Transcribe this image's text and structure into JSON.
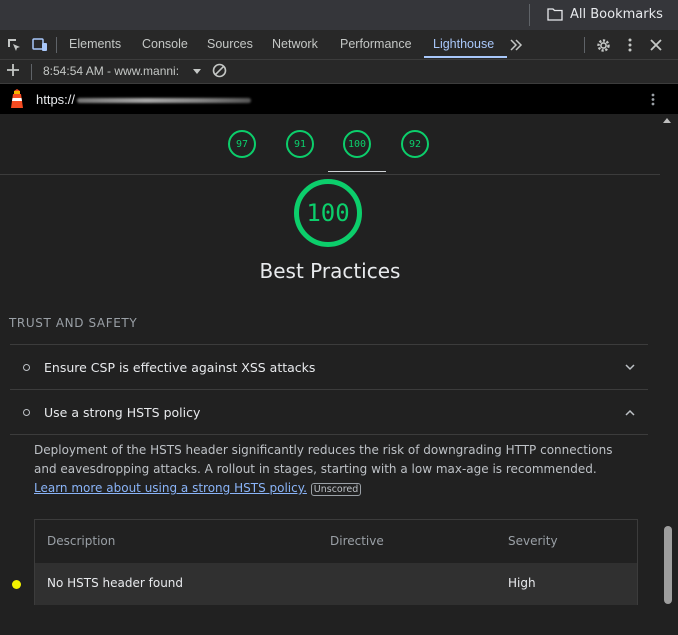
{
  "bookmarks_bar": {
    "all_bookmarks_label": "All Bookmarks"
  },
  "devtools": {
    "tabs": [
      {
        "label": "Elements"
      },
      {
        "label": "Console"
      },
      {
        "label": "Sources"
      },
      {
        "label": "Network"
      },
      {
        "label": "Performance"
      },
      {
        "label": "Lighthouse",
        "active": true
      }
    ]
  },
  "lighthouse_toolbar": {
    "report_label": "8:54:54 AM - www.manni:"
  },
  "url_bar": {
    "url_prefix": "https://"
  },
  "scores": {
    "gauges": [
      {
        "value": "97"
      },
      {
        "value": "91"
      },
      {
        "value": "100",
        "active": true
      },
      {
        "value": "92"
      }
    ],
    "category_score": "100",
    "category_title": "Best Practices"
  },
  "group": {
    "title": "TRUST AND SAFETY"
  },
  "audits": [
    {
      "title": "Ensure CSP is effective against XSS attacks",
      "expanded": false
    },
    {
      "title": "Use a strong HSTS policy",
      "expanded": true
    }
  ],
  "hsts": {
    "description": "Deployment of the HSTS header significantly reduces the risk of downgrading HTTP connections and eavesdropping attacks. A rollout in stages, starting with a low max-age is recommended.",
    "learn_more": "Learn more about using a strong HSTS policy.",
    "unscored": "Unscored",
    "table": {
      "headers": [
        "Description",
        "Directive",
        "Severity"
      ],
      "rows": [
        {
          "description": "No HSTS header found",
          "directive": "",
          "severity": "High"
        }
      ]
    }
  },
  "colors": {
    "pass": "#0cce6b",
    "accent": "#a8c7fa",
    "link": "#8ab4f8"
  }
}
